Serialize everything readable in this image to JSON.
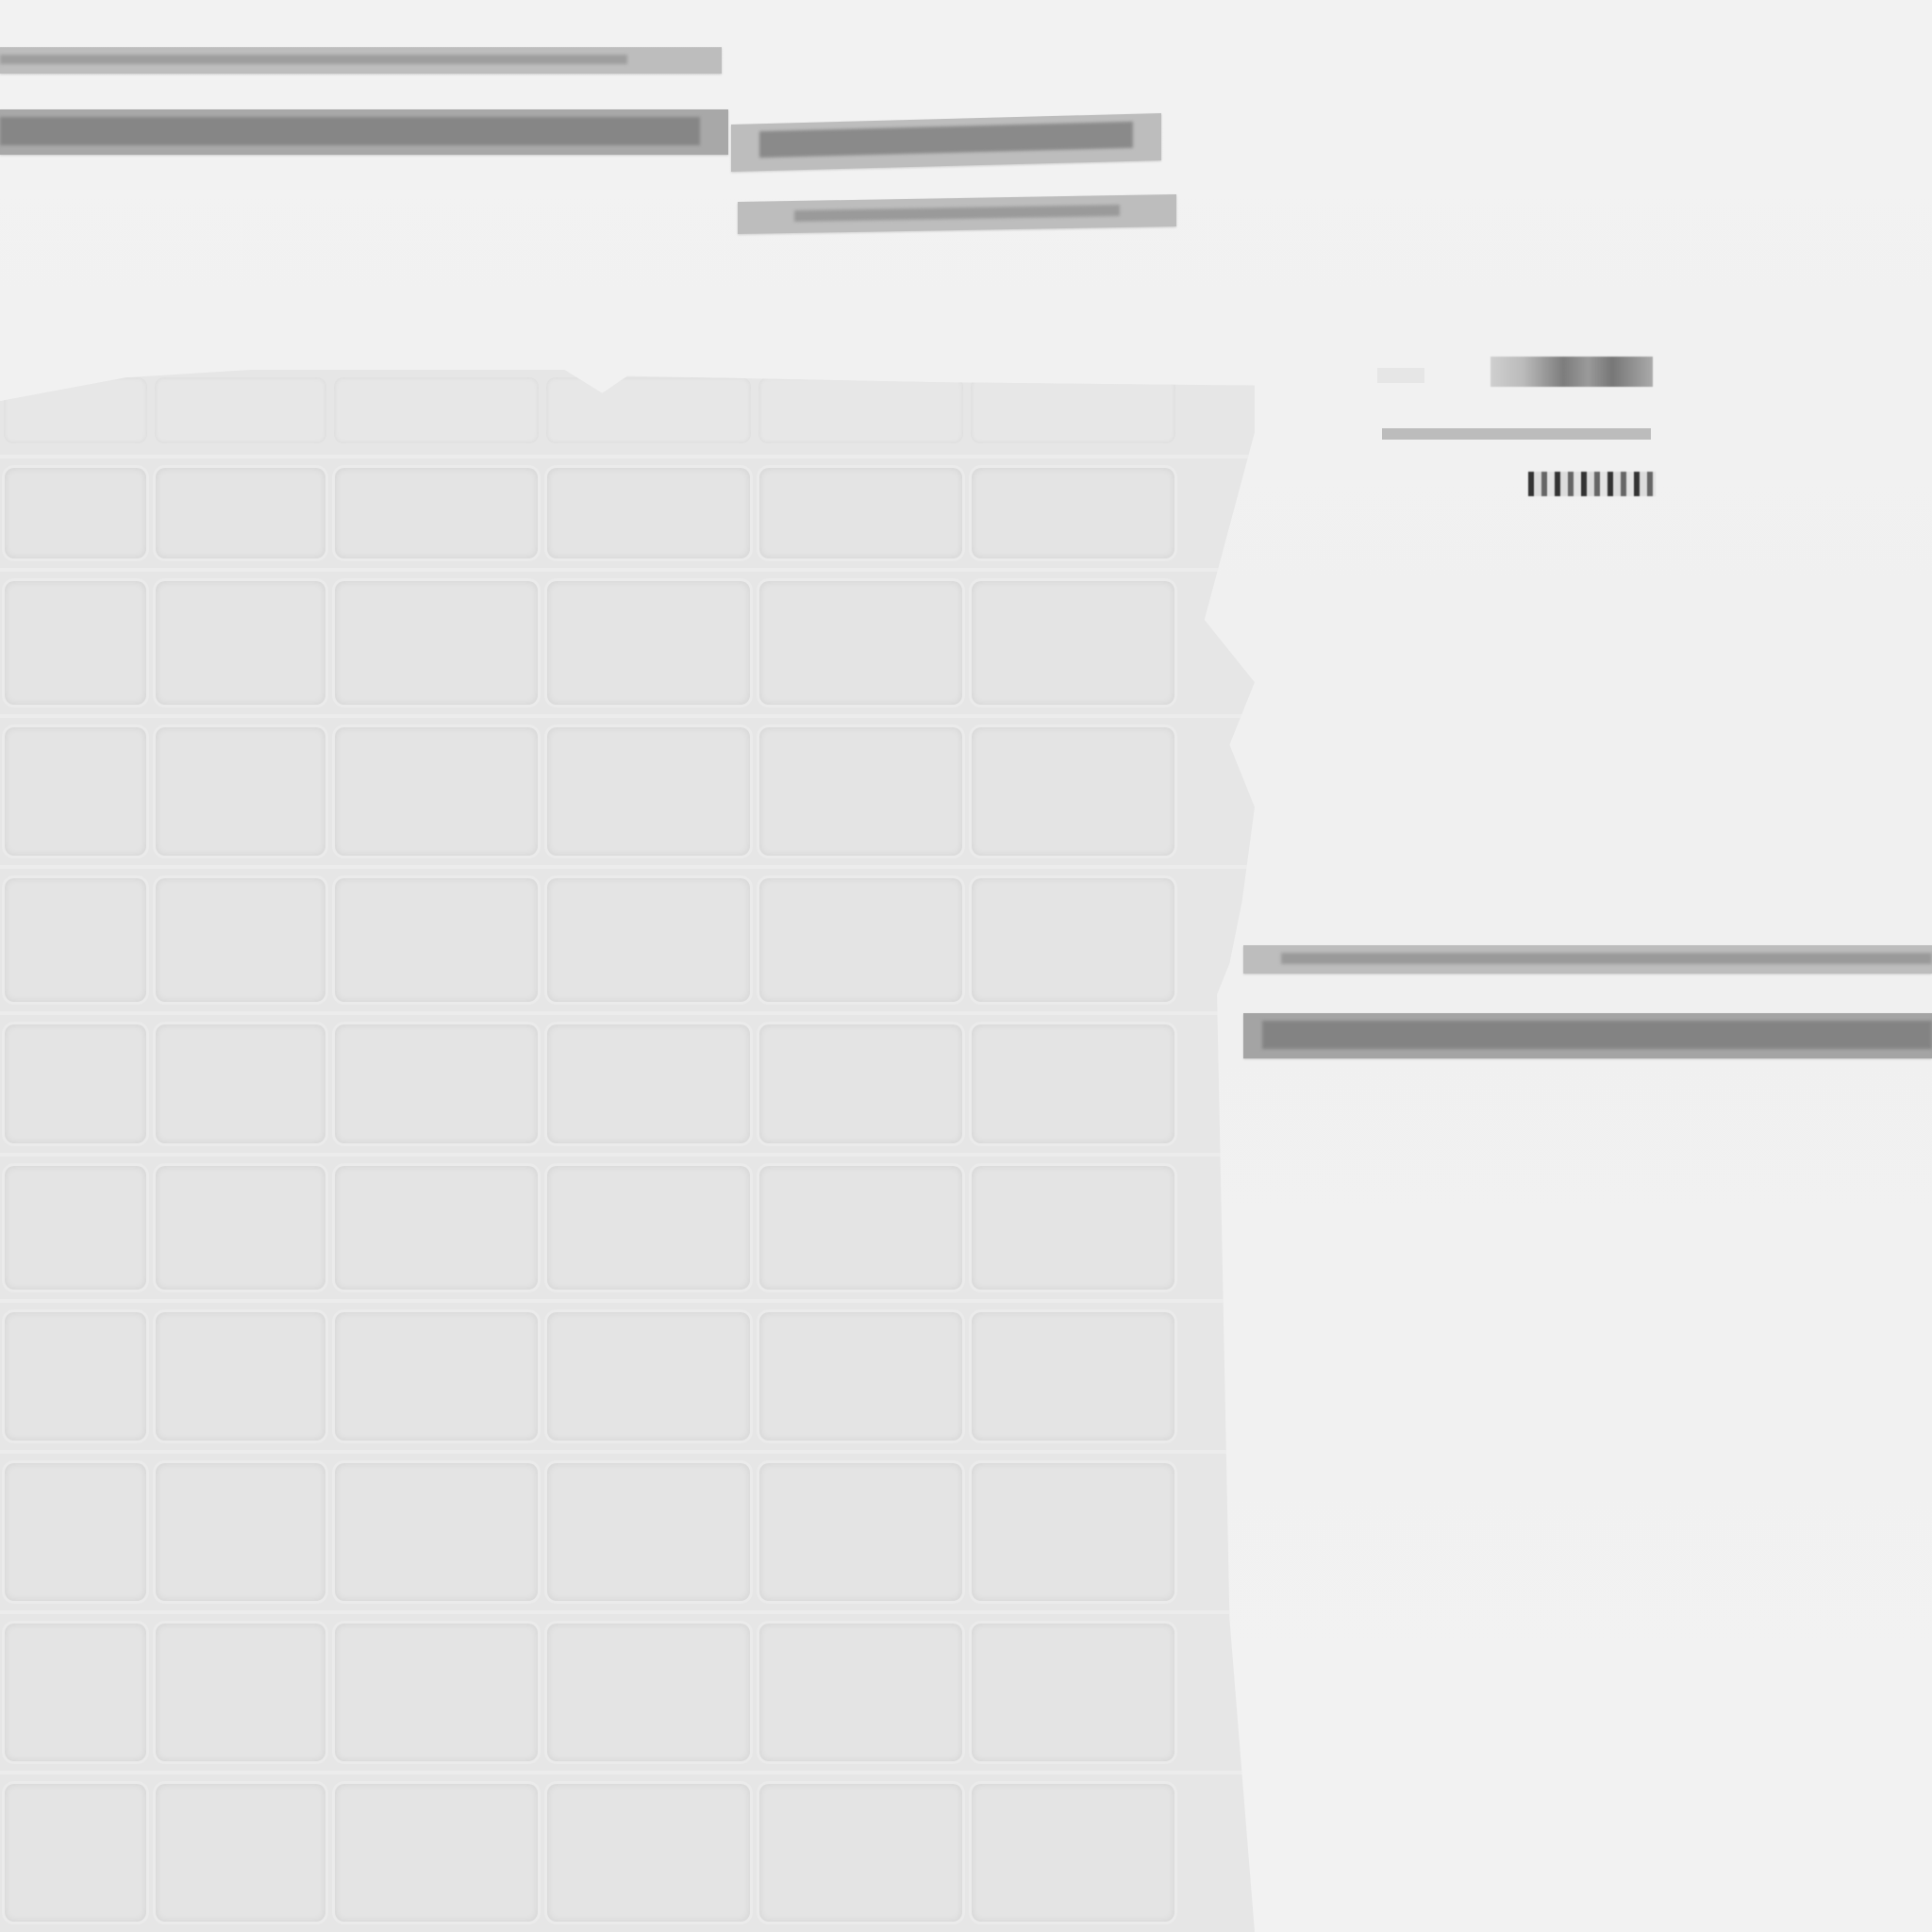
{
  "grid": {
    "columns": 6,
    "rows": 10
  },
  "colors": {
    "background": "#f1f1f1",
    "grid_panel": "#e6e6e6",
    "cell": "#e4e4e4",
    "strip": "#bdbdbd",
    "strip_core": "#8a8a8a"
  }
}
